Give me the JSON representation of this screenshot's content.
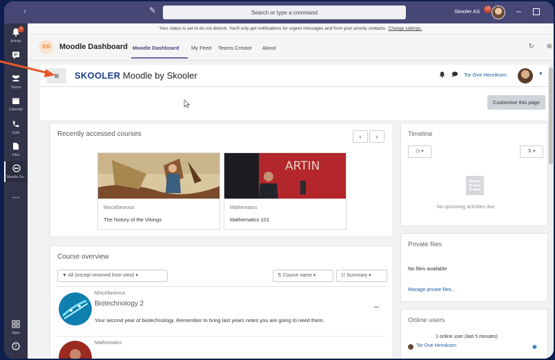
{
  "titlebar": {
    "search_placeholder": "Search or type a command",
    "org_name": "Skooler AS",
    "notification_count": "10",
    "back_glyph": "›",
    "compose_glyph": "✎",
    "minimize_glyph": "–"
  },
  "rail": {
    "items": [
      {
        "label": "Activity",
        "icon": "bell-icon",
        "badge": "3"
      },
      {
        "label": "Chat",
        "icon": "chat-icon"
      },
      {
        "label": "Teams",
        "icon": "teams-icon"
      },
      {
        "label": "Calendar",
        "icon": "calendar-icon"
      },
      {
        "label": "Calls",
        "icon": "phone-icon"
      },
      {
        "label": "Files",
        "icon": "file-icon"
      },
      {
        "label": "Moodle Da...",
        "icon": "moodle-icon"
      },
      {
        "label": "...",
        "icon": "more-icon"
      },
      {
        "label": "Apps",
        "icon": "apps-icon"
      },
      {
        "label": "Help",
        "icon": "help-icon"
      }
    ]
  },
  "notice": {
    "text": "Your status is set to do not disturb. You'll only get notifications for urgent messages and from your priority contacts.",
    "link": "Change settings."
  },
  "appbar": {
    "logo_text": "co",
    "title": "Moodle Dashboard",
    "tabs": [
      "Moodle Dashboard",
      "My Feed",
      "Teams Creator",
      "About"
    ]
  },
  "moodle": {
    "brand_logo": "SKOOLER",
    "brand_text": "Moodle by Skooler",
    "user_name": "Tor Ove Henriksen",
    "customise_label": "Customise this page",
    "recent": {
      "title": "Recently accessed courses",
      "prev_glyph": "‹",
      "next_glyph": "›",
      "courses": [
        {
          "category": "Miscellaneous",
          "name": "The history of the Vikings"
        },
        {
          "category": "Mathematics",
          "name": "Mathematics 101",
          "image_text": "ARTIN"
        }
      ]
    },
    "overview": {
      "title": "Course overview",
      "filter_label": "All (except removed from view)",
      "sort_label": "Course name",
      "view_label": "Summary",
      "items": [
        {
          "category": "Miscellaneous",
          "name": "Biotechnology 2",
          "description": "Your second year of biotechnology. Remember to bring last years notes you are going to need them.",
          "menu": "..."
        },
        {
          "category": "Mathematics",
          "name": ""
        }
      ]
    },
    "timeline": {
      "title": "Timeline",
      "empty_text": "No upcoming activities due"
    },
    "private_files": {
      "title": "Private files",
      "empty_text": "No files available",
      "manage_link": "Manage private files..."
    },
    "online_users": {
      "title": "Online users",
      "summary": "1 online user (last 5 minutes)",
      "user": "Tor Ove Henriksen"
    }
  },
  "colors": {
    "teams_titlebar": "#464775",
    "rail": "#33344a",
    "moodle_brand": "#1b3b87",
    "link": "#1b5ea8",
    "annotation_arrow": "#e8572a"
  }
}
